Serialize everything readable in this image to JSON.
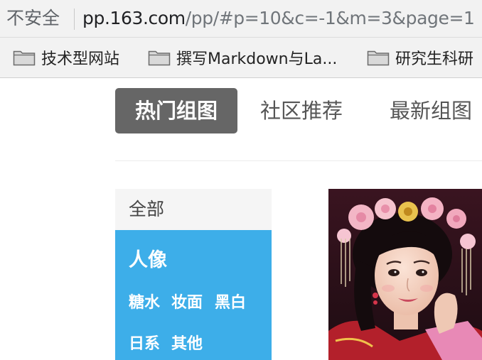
{
  "addressbar": {
    "security_label": "不安全",
    "url_host": "pp.163.com",
    "url_path": "/pp/#p=10&c=-1&m=3&page=1"
  },
  "bookmarks": [
    {
      "label": "技术型网站",
      "icon": "folder-icon"
    },
    {
      "label": "撰写Markdown与La...",
      "icon": "folder-icon"
    },
    {
      "label": "研究生科研",
      "icon": "folder-icon"
    }
  ],
  "nav": {
    "tabs": [
      {
        "label": "热门组图",
        "active": true
      },
      {
        "label": "社区推荐",
        "active": false
      },
      {
        "label": "最新组图",
        "active": false
      }
    ]
  },
  "categories": {
    "all_label": "全部",
    "active_title": "人像",
    "subcategories": [
      "糖水",
      "妆面",
      "黑白",
      "日系",
      "其他"
    ]
  },
  "colors": {
    "active_tab_bg": "#666666",
    "category_panel_bg": "#3daee9",
    "browser_chrome_bg": "#f2f2f2"
  }
}
